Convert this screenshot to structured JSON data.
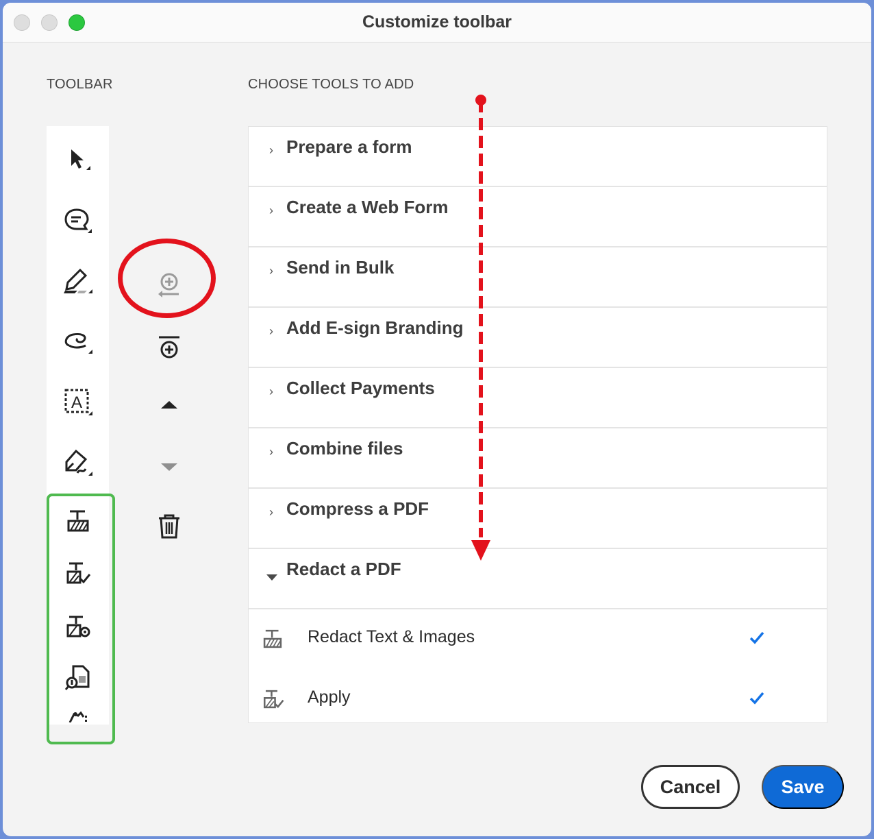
{
  "window": {
    "title": "Customize toolbar",
    "traffic_lights": [
      "close",
      "minimize",
      "maximize"
    ]
  },
  "toolbar_section": {
    "label": "TOOLBAR",
    "tools": [
      {
        "icon": "select-arrow-icon"
      },
      {
        "icon": "comment-icon"
      },
      {
        "icon": "highlight-pen-icon"
      },
      {
        "icon": "freehand-draw-icon"
      },
      {
        "icon": "text-box-icon"
      },
      {
        "icon": "fill-sign-pen-icon"
      },
      {
        "icon": "redact-text-images-icon"
      },
      {
        "icon": "apply-redaction-icon"
      },
      {
        "icon": "redaction-properties-icon"
      },
      {
        "icon": "sanitize-document-icon"
      },
      {
        "icon": "redact-partial-icon"
      }
    ]
  },
  "actions": [
    {
      "icon": "add-tool-icon",
      "state": "disabled"
    },
    {
      "icon": "add-divider-icon",
      "state": "enabled"
    },
    {
      "icon": "move-up-icon",
      "state": "enabled"
    },
    {
      "icon": "move-down-icon",
      "state": "disabled"
    },
    {
      "icon": "delete-icon",
      "state": "enabled"
    }
  ],
  "choose_section": {
    "label": "CHOOSE TOOLS TO ADD",
    "categories": [
      {
        "label": "Prepare a form",
        "expanded": false
      },
      {
        "label": "Create a Web Form",
        "expanded": false
      },
      {
        "label": "Send in Bulk",
        "expanded": false
      },
      {
        "label": "Add E-sign Branding",
        "expanded": false
      },
      {
        "label": "Collect Payments",
        "expanded": false
      },
      {
        "label": "Combine files",
        "expanded": false
      },
      {
        "label": "Compress a PDF",
        "expanded": false
      },
      {
        "label": "Redact a PDF",
        "expanded": true
      }
    ],
    "redact_tools": [
      {
        "label": "Redact Text & Images",
        "checked": true,
        "icon": "redact-text-images-icon"
      },
      {
        "label": "Apply",
        "checked": true,
        "icon": "apply-redaction-icon"
      }
    ]
  },
  "buttons": {
    "cancel": "Cancel",
    "save": "Save"
  },
  "colors": {
    "accent": "#0f6ad6",
    "annotation_red": "#e3121c",
    "annotation_green": "#4fba4f",
    "check_blue": "#1473e6"
  }
}
